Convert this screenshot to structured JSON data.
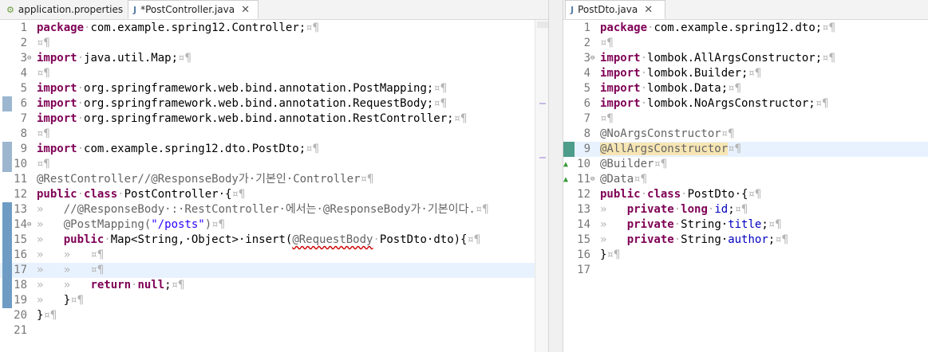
{
  "left_tabs": [
    {
      "label": "application.properties",
      "icon": "properties-file-icon",
      "active": false
    },
    {
      "label": "*PostController.java",
      "icon": "java-file-icon",
      "active": true,
      "close": "✕"
    }
  ],
  "right_tabs": [
    {
      "label": "PostDto.java",
      "icon": "java-file-icon",
      "active": true,
      "close": "✕"
    }
  ],
  "left_editor": {
    "current_line": 17,
    "lines": [
      {
        "n": "1",
        "parts": [
          [
            "kw",
            "package"
          ],
          [
            "ws",
            "·"
          ],
          [
            "",
            "com.example.spring12.Controller;"
          ],
          [
            "ws",
            "¤¶"
          ]
        ]
      },
      {
        "n": "2",
        "parts": [
          [
            "ws",
            "¤¶"
          ]
        ]
      },
      {
        "n": "3",
        "fold": "⊖",
        "parts": [
          [
            "kw",
            "import"
          ],
          [
            "ws",
            "·"
          ],
          [
            "",
            "java.util.Map;"
          ],
          [
            "ws",
            "¤¶"
          ]
        ]
      },
      {
        "n": "4",
        "parts": [
          [
            "ws",
            "¤¶"
          ]
        ]
      },
      {
        "n": "5",
        "parts": [
          [
            "kw",
            "import"
          ],
          [
            "ws",
            "·"
          ],
          [
            "",
            "org.springframework.web.bind.annotation.PostMapping;"
          ],
          [
            "ws",
            "¤¶"
          ]
        ]
      },
      {
        "n": "6",
        "mark": "light",
        "parts": [
          [
            "kw",
            "import"
          ],
          [
            "ws",
            "·"
          ],
          [
            "",
            "org.springframework.web.bind.annotation.RequestBody;"
          ],
          [
            "ws",
            "¤¶"
          ]
        ]
      },
      {
        "n": "7",
        "parts": [
          [
            "kw",
            "import"
          ],
          [
            "ws",
            "·"
          ],
          [
            "",
            "org.springframework.web.bind.annotation.RestController;"
          ],
          [
            "ws",
            "¤¶"
          ]
        ]
      },
      {
        "n": "8",
        "parts": [
          [
            "ws",
            "¤¶"
          ]
        ]
      },
      {
        "n": "9",
        "mark": "light",
        "parts": [
          [
            "kw",
            "import"
          ],
          [
            "ws",
            "·"
          ],
          [
            "",
            "com.example.spring12.dto.PostDto;"
          ],
          [
            "ws",
            "¤¶"
          ]
        ]
      },
      {
        "n": "10",
        "mark": "light",
        "parts": [
          [
            "ws",
            "¤¶"
          ]
        ]
      },
      {
        "n": "11",
        "parts": [
          [
            "ann",
            "@RestController//@ResponseBody가·기본인·Controller"
          ],
          [
            "ws",
            "¤¶"
          ]
        ]
      },
      {
        "n": "12",
        "parts": [
          [
            "kw",
            "public"
          ],
          [
            "ws",
            "·"
          ],
          [
            "kw",
            "class"
          ],
          [
            "ws",
            "·"
          ],
          [
            "",
            "PostController·{"
          ],
          [
            "ws",
            "¤¶"
          ]
        ]
      },
      {
        "n": "13",
        "mark": "dark",
        "parts": [
          [
            "ws",
            "»   "
          ],
          [
            "ann",
            "//@ResponseBody·:·RestController·에서는·@ResponseBody가·기본이다."
          ],
          [
            "ws",
            "¤¶"
          ]
        ]
      },
      {
        "n": "14",
        "mark": "dark",
        "fold": "⊖",
        "parts": [
          [
            "ws",
            "»   "
          ],
          [
            "ann",
            "@PostMapping("
          ],
          [
            "str",
            "\"/posts\""
          ],
          [
            "ann",
            ")"
          ],
          [
            "ws",
            "¤¶"
          ]
        ]
      },
      {
        "n": "15",
        "mark": "dark",
        "parts": [
          [
            "ws",
            "»   "
          ],
          [
            "kw",
            "public"
          ],
          [
            "ws",
            "·"
          ],
          [
            "",
            "Map<String,·Object>·insert("
          ],
          [
            "sq",
            "@RequestBody"
          ],
          [
            "ws",
            "·"
          ],
          [
            "",
            "PostDto·dto){"
          ],
          [
            "ws",
            "¤¶"
          ]
        ]
      },
      {
        "n": "16",
        "mark": "dark",
        "parts": [
          [
            "ws",
            "»   »   ¤¶"
          ]
        ]
      },
      {
        "n": "17",
        "mark": "dark",
        "parts": [
          [
            "ws",
            "»   »   ¤¶"
          ]
        ]
      },
      {
        "n": "18",
        "mark": "dark",
        "parts": [
          [
            "ws",
            "»   »   "
          ],
          [
            "kw",
            "return"
          ],
          [
            "ws",
            "·"
          ],
          [
            "kw",
            "null"
          ],
          [
            "",
            ";"
          ],
          [
            "ws",
            "¤¶"
          ]
        ]
      },
      {
        "n": "19",
        "mark": "dark",
        "parts": [
          [
            "ws",
            "»   "
          ],
          [
            "",
            "}"
          ],
          [
            "ws",
            "¤¶"
          ]
        ]
      },
      {
        "n": "20",
        "parts": [
          [
            "",
            "}"
          ],
          [
            "ws",
            "¤¶"
          ]
        ]
      },
      {
        "n": "21",
        "parts": []
      }
    ]
  },
  "right_editor": {
    "current_line": 9,
    "lines": [
      {
        "n": "1",
        "parts": [
          [
            "kw",
            "package"
          ],
          [
            "ws",
            "·"
          ],
          [
            "",
            "com.example.spring12.dto;"
          ],
          [
            "ws",
            "¤¶"
          ]
        ]
      },
      {
        "n": "2",
        "parts": [
          [
            "ws",
            "¤¶"
          ]
        ]
      },
      {
        "n": "3",
        "fold": "⊖",
        "parts": [
          [
            "kw",
            "import"
          ],
          [
            "ws",
            "·"
          ],
          [
            "",
            "lombok.AllArgsConstructor;"
          ],
          [
            "ws",
            "¤¶"
          ]
        ]
      },
      {
        "n": "4",
        "parts": [
          [
            "kw",
            "import"
          ],
          [
            "ws",
            "·"
          ],
          [
            "",
            "lombok.Builder;"
          ],
          [
            "ws",
            "¤¶"
          ]
        ]
      },
      {
        "n": "5",
        "parts": [
          [
            "kw",
            "import"
          ],
          [
            "ws",
            "·"
          ],
          [
            "",
            "lombok.Data;"
          ],
          [
            "ws",
            "¤¶"
          ]
        ]
      },
      {
        "n": "6",
        "parts": [
          [
            "kw",
            "import"
          ],
          [
            "ws",
            "·"
          ],
          [
            "",
            "lombok.NoArgsConstructor;"
          ],
          [
            "ws",
            "¤¶"
          ]
        ]
      },
      {
        "n": "7",
        "parts": [
          [
            "ws",
            "¤¶"
          ]
        ]
      },
      {
        "n": "8",
        "parts": [
          [
            "ann",
            "@NoArgsConstructor"
          ],
          [
            "ws",
            "¤¶"
          ]
        ]
      },
      {
        "n": "9",
        "mark": "teal",
        "parts": [
          [
            "hl",
            "@AllArgsConstructor"
          ],
          [
            "ws",
            "¤¶"
          ]
        ]
      },
      {
        "n": "10",
        "warn": "▲",
        "parts": [
          [
            "ann",
            "@Builder"
          ],
          [
            "ws",
            "¤¶"
          ]
        ]
      },
      {
        "n": "11",
        "warn": "▲",
        "fold": "⊖",
        "parts": [
          [
            "ann",
            "@Data"
          ],
          [
            "ws",
            "¤¶"
          ]
        ]
      },
      {
        "n": "12",
        "parts": [
          [
            "kw",
            "public"
          ],
          [
            "ws",
            "·"
          ],
          [
            "kw",
            "class"
          ],
          [
            "ws",
            "·"
          ],
          [
            "",
            "PostDto·{"
          ],
          [
            "ws",
            "¤¶"
          ]
        ]
      },
      {
        "n": "13",
        "parts": [
          [
            "ws",
            "»   "
          ],
          [
            "kw",
            "private"
          ],
          [
            "ws",
            "·"
          ],
          [
            "kw",
            "long"
          ],
          [
            "ws",
            "·"
          ],
          [
            "fld",
            "id"
          ],
          [
            "",
            ";"
          ],
          [
            "ws",
            "¤¶"
          ]
        ]
      },
      {
        "n": "14",
        "parts": [
          [
            "ws",
            "»   "
          ],
          [
            "kw",
            "private"
          ],
          [
            "ws",
            "·"
          ],
          [
            "",
            "String·"
          ],
          [
            "fld",
            "title"
          ],
          [
            "",
            ";"
          ],
          [
            "ws",
            "¤¶"
          ]
        ]
      },
      {
        "n": "15",
        "parts": [
          [
            "ws",
            "»   "
          ],
          [
            "kw",
            "private"
          ],
          [
            "ws",
            "·"
          ],
          [
            "",
            "String·"
          ],
          [
            "fld",
            "author"
          ],
          [
            "",
            ";"
          ],
          [
            "ws",
            "¤¶"
          ]
        ]
      },
      {
        "n": "16",
        "parts": [
          [
            "",
            "}"
          ],
          [
            "ws",
            "¤¶"
          ]
        ]
      },
      {
        "n": "17",
        "parts": []
      }
    ]
  },
  "colors": {
    "keyword": "#7f0055",
    "annotation": "#646464",
    "string": "#2a00ff",
    "field": "#0000c0",
    "current_line": "#e8f2fe"
  }
}
